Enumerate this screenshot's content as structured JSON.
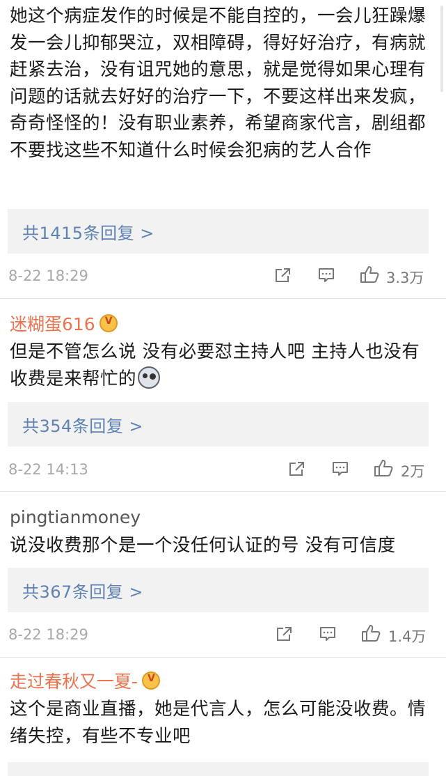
{
  "comments": [
    {
      "username": "",
      "text": "她这个病症发作的时候是不能自控的，一会儿狂躁爆发一会儿抑郁哭泣，双相障碍，得好好治疗，有病就赶紧去治，没有诅咒她的意思，就是觉得如果心理有问题的话就去好好的治疗一下，不要这样出来发疯，奇奇怪怪的！没有职业素养，希望商家代言，剧组都不要找这些不知道什么时候会犯病的艺人合作",
      "reply_label": "共1415条回复 >",
      "time": "8-22 18:29",
      "likes": "3.3万"
    },
    {
      "username": "迷糊蛋616",
      "text": "但是不管怎么说 没有必要怼主持人吧 主持人也没有收费是来帮忙的",
      "reply_label": "共354条回复 >",
      "time": "8-22 14:13",
      "likes": "2万"
    },
    {
      "username": "pingtianmoney",
      "text": "说没收费那个是一个没任何认证的号 没有可信度",
      "reply_label": "共367条回复 >",
      "time": "8-22 18:29",
      "likes": "1.4万"
    },
    {
      "username": "走过春秋又一夏-",
      "text": "这个是商业直播，她是代言人，怎么可能没收费。情绪失控，有些不专业吧",
      "reply_label": "",
      "time": "",
      "likes": ""
    }
  ],
  "icons": {
    "share": "share-icon",
    "comment": "comment-icon",
    "like": "thumbs-up-icon",
    "vip": "crown-badge-icon",
    "emoji": "emoji-face-icon"
  },
  "colors": {
    "username_orange": "#eb7350",
    "reply_link": "#5e82b4",
    "reply_bg": "#f2f2f2",
    "meta_gray": "#a8a8a8"
  }
}
